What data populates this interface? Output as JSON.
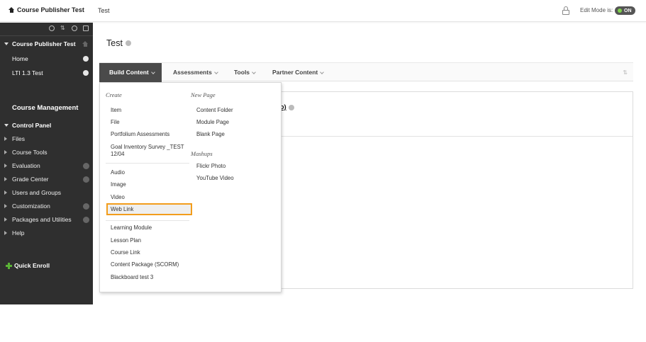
{
  "topbar": {
    "course_name": "Course Publisher Test",
    "current_page": "Test",
    "edit_mode_label": "Edit Mode is:",
    "edit_mode_value": "ON"
  },
  "sidebar": {
    "course_title": "Course Publisher Test",
    "course_links": [
      {
        "label": "Home"
      },
      {
        "label": "LTI 1.3 Test"
      }
    ],
    "management_header": "Course Management",
    "control_panel": "Control Panel",
    "control_items": [
      {
        "label": "Files",
        "has_icon": false
      },
      {
        "label": "Course Tools",
        "has_icon": false
      },
      {
        "label": "Evaluation",
        "has_icon": true
      },
      {
        "label": "Grade Center",
        "has_icon": true
      },
      {
        "label": "Users and Groups",
        "has_icon": false
      },
      {
        "label": "Customization",
        "has_icon": true
      },
      {
        "label": "Packages and Utilities",
        "has_icon": true
      },
      {
        "label": "Help",
        "has_icon": false
      }
    ],
    "quick_enroll": "Quick Enroll"
  },
  "main": {
    "page_title": "Test",
    "action_bar": [
      {
        "label": "Build Content",
        "active": true
      },
      {
        "label": "Assessments",
        "active": false
      },
      {
        "label": "Tools",
        "active": false
      },
      {
        "label": "Partner Content",
        "active": false
      }
    ],
    "content_item_partial": "emo)"
  },
  "dropdown": {
    "create_heading": "Create",
    "create_group1": [
      "Item",
      "File",
      "Portfolium Assessments",
      "Goal Inventory Survey _TEST",
      "12/04"
    ],
    "create_group2": [
      "Audio",
      "Image",
      "Video",
      "Web Link"
    ],
    "create_group3": [
      "Learning Module",
      "Lesson Plan",
      "Course Link",
      "Content Package (SCORM)",
      "Blackboard test 3"
    ],
    "new_page_heading": "New Page",
    "new_page_items": [
      "Content Folder",
      "Module Page",
      "Blank Page"
    ],
    "mashups_heading": "Mashups",
    "mashups_items": [
      "Flickr Photo",
      "YouTube Video"
    ],
    "highlight_color": "#f29d1c"
  }
}
